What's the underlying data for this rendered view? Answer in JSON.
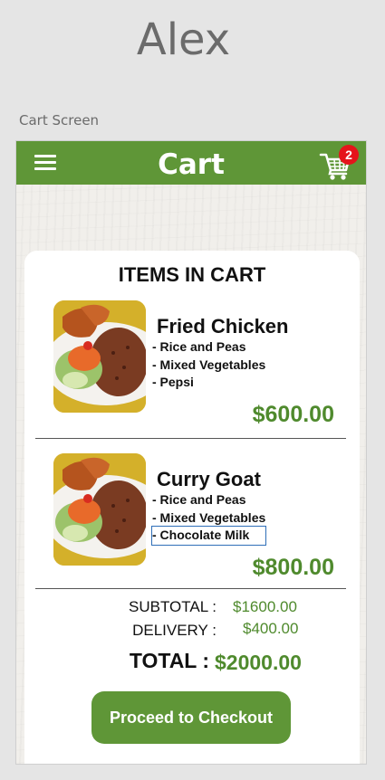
{
  "board": {
    "title": "Alex",
    "screen_label": "Cart Screen"
  },
  "app": {
    "title": "Cart",
    "cart_count": "2",
    "colors": {
      "brand": "#5f9637",
      "price": "#4f8a2d",
      "badge": "#e5141b"
    }
  },
  "cart": {
    "heading": "ITEMS IN CART",
    "items": [
      {
        "name": "Fried Chicken",
        "sides": [
          "- Rice and Peas",
          "- Mixed Vegetables",
          "- Pepsi"
        ],
        "price": "$600.00"
      },
      {
        "name": "Curry Goat",
        "sides": [
          "- Rice and Peas",
          "- Mixed Vegetables",
          "- Chocolate Milk"
        ],
        "price": "$800.00"
      }
    ],
    "summary": {
      "subtotal_label": "SUBTOTAL :",
      "subtotal_value": "$1600.00",
      "delivery_label": "DELIVERY :",
      "delivery_value": "$400.00",
      "total_label": "TOTAL :",
      "total_value": "$2000.00"
    },
    "checkout_label": "Proceed to Checkout"
  }
}
